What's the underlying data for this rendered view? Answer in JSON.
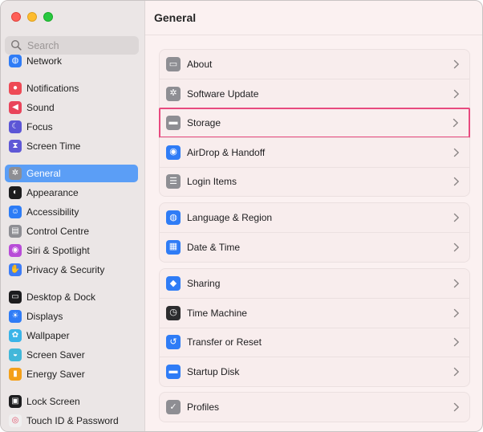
{
  "sidebar": {
    "search_placeholder": "Search",
    "items": [
      {
        "label": "Network",
        "icon": "globe-icon",
        "color": "#2f7cf6"
      },
      {
        "label": "Notifications",
        "icon": "bell-icon",
        "color": "#ee4a55"
      },
      {
        "label": "Sound",
        "icon": "speaker-icon",
        "color": "#e9445a"
      },
      {
        "label": "Focus",
        "icon": "moon-icon",
        "color": "#5c56d6"
      },
      {
        "label": "Screen Time",
        "icon": "hourglass-icon",
        "color": "#5f58d6"
      },
      {
        "label": "General",
        "icon": "gear-icon",
        "color": "#8e8e93"
      },
      {
        "label": "Appearance",
        "icon": "appearance-icon",
        "color": "#1c1c1e"
      },
      {
        "label": "Accessibility",
        "icon": "accessibility-icon",
        "color": "#2d7cf6"
      },
      {
        "label": "Control Centre",
        "icon": "control-centre-icon",
        "color": "#8e8e93"
      },
      {
        "label": "Siri & Spotlight",
        "icon": "siri-icon",
        "color": "#b84cd8"
      },
      {
        "label": "Privacy & Security",
        "icon": "hand-icon",
        "color": "#3d7cf6"
      },
      {
        "label": "Desktop & Dock",
        "icon": "dock-icon",
        "color": "#1c1c1e"
      },
      {
        "label": "Displays",
        "icon": "sun-icon",
        "color": "#2f7cf6"
      },
      {
        "label": "Wallpaper",
        "icon": "flower-icon",
        "color": "#3ab4e8"
      },
      {
        "label": "Screen Saver",
        "icon": "screen-saver-icon",
        "color": "#42b7d9"
      },
      {
        "label": "Energy Saver",
        "icon": "battery-icon",
        "color": "#f4a019"
      },
      {
        "label": "Lock Screen",
        "icon": "lock-screen-icon",
        "color": "#1c1c1e"
      },
      {
        "label": "Touch ID & Password",
        "icon": "fingerprint-icon",
        "color": "#f0f0f0"
      }
    ],
    "active_label": "General"
  },
  "main": {
    "title": "General",
    "groups": [
      [
        {
          "label": "About",
          "icon": "about-icon",
          "color": "#8e8e93"
        },
        {
          "label": "Software Update",
          "icon": "gear-badge-icon",
          "color": "#8e8e93"
        },
        {
          "label": "Storage",
          "icon": "storage-icon",
          "color": "#8e8e93"
        },
        {
          "label": "AirDrop & Handoff",
          "icon": "airdrop-icon",
          "color": "#2f7cf6"
        },
        {
          "label": "Login Items",
          "icon": "login-items-icon",
          "color": "#8e8e93"
        }
      ],
      [
        {
          "label": "Language & Region",
          "icon": "globe-icon",
          "color": "#2f7cf6"
        },
        {
          "label": "Date & Time",
          "icon": "calendar-clock-icon",
          "color": "#2f7cf6"
        }
      ],
      [
        {
          "label": "Sharing",
          "icon": "sharing-icon",
          "color": "#2f7cf6"
        },
        {
          "label": "Time Machine",
          "icon": "time-machine-icon",
          "color": "#2c2c2e"
        },
        {
          "label": "Transfer or Reset",
          "icon": "reset-icon",
          "color": "#2f7cf6"
        },
        {
          "label": "Startup Disk",
          "icon": "startup-disk-icon",
          "color": "#2f7cf6"
        }
      ],
      [
        {
          "label": "Profiles",
          "icon": "profiles-icon",
          "color": "#8e8e93"
        }
      ]
    ],
    "highlighted_label": "Storage",
    "highlight_color": "#e84a7f"
  }
}
